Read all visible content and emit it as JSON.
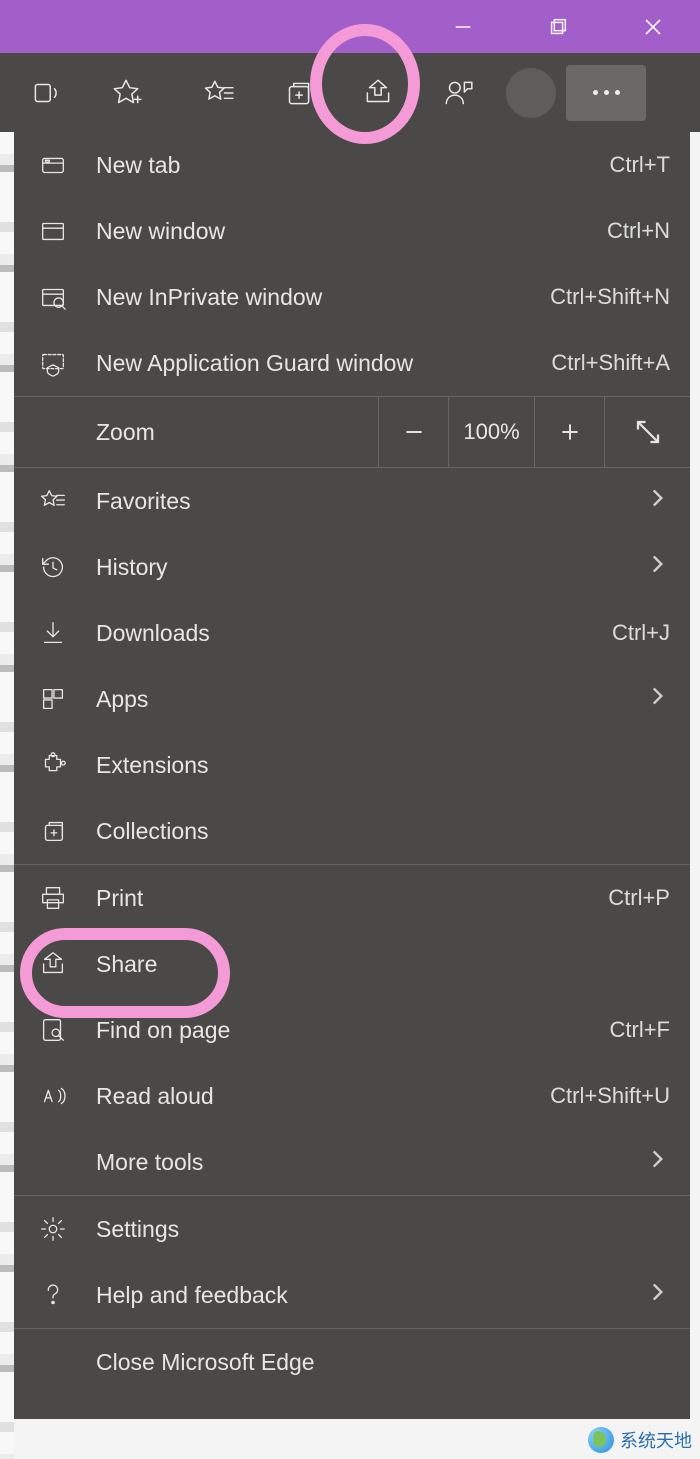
{
  "titlebar": {
    "minimize": "—",
    "maximize": "❐",
    "close": "✕"
  },
  "toolbar": {
    "icons": [
      "read-aloud-icon",
      "add-favorite-icon",
      "favorites-icon",
      "collections-toolbar-icon",
      "share-toolbar-icon",
      "feedback-icon"
    ],
    "more": "..."
  },
  "menu": {
    "sections": [
      {
        "items": [
          {
            "id": "new-tab",
            "label": "New tab",
            "shortcut": "Ctrl+T",
            "icon": "tab-icon"
          },
          {
            "id": "new-window",
            "label": "New window",
            "shortcut": "Ctrl+N",
            "icon": "window-icon"
          },
          {
            "id": "new-inprivate",
            "label": "New InPrivate window",
            "shortcut": "Ctrl+Shift+N",
            "icon": "inprivate-icon"
          },
          {
            "id": "new-appguard",
            "label": "New Application Guard window",
            "shortcut": "Ctrl+Shift+A",
            "icon": "appguard-icon"
          }
        ]
      },
      {
        "zoom": {
          "label": "Zoom",
          "value": "100%"
        }
      },
      {
        "items": [
          {
            "id": "favorites",
            "label": "Favorites",
            "submenu": true,
            "icon": "star-list-icon"
          },
          {
            "id": "history",
            "label": "History",
            "submenu": true,
            "icon": "history-icon"
          },
          {
            "id": "downloads",
            "label": "Downloads",
            "shortcut": "Ctrl+J",
            "icon": "download-icon"
          },
          {
            "id": "apps",
            "label": "Apps",
            "submenu": true,
            "icon": "apps-icon"
          },
          {
            "id": "extensions",
            "label": "Extensions",
            "icon": "extension-icon"
          },
          {
            "id": "collections",
            "label": "Collections",
            "icon": "collections-icon"
          }
        ]
      },
      {
        "items": [
          {
            "id": "print",
            "label": "Print",
            "shortcut": "Ctrl+P",
            "icon": "print-icon"
          },
          {
            "id": "share",
            "label": "Share",
            "icon": "share-icon"
          },
          {
            "id": "find",
            "label": "Find on page",
            "shortcut": "Ctrl+F",
            "icon": "find-icon"
          },
          {
            "id": "read-aloud",
            "label": "Read aloud",
            "shortcut": "Ctrl+Shift+U",
            "icon": "read-aloud-menu-icon"
          },
          {
            "id": "more-tools",
            "label": "More tools",
            "submenu": true,
            "icon": ""
          }
        ]
      },
      {
        "items": [
          {
            "id": "settings",
            "label": "Settings",
            "icon": "gear-icon"
          },
          {
            "id": "help",
            "label": "Help and feedback",
            "submenu": true,
            "icon": "help-icon"
          }
        ]
      },
      {
        "items": [
          {
            "id": "close-edge",
            "label": "Close Microsoft Edge",
            "icon": ""
          }
        ]
      }
    ]
  },
  "watermark": "系统天地"
}
